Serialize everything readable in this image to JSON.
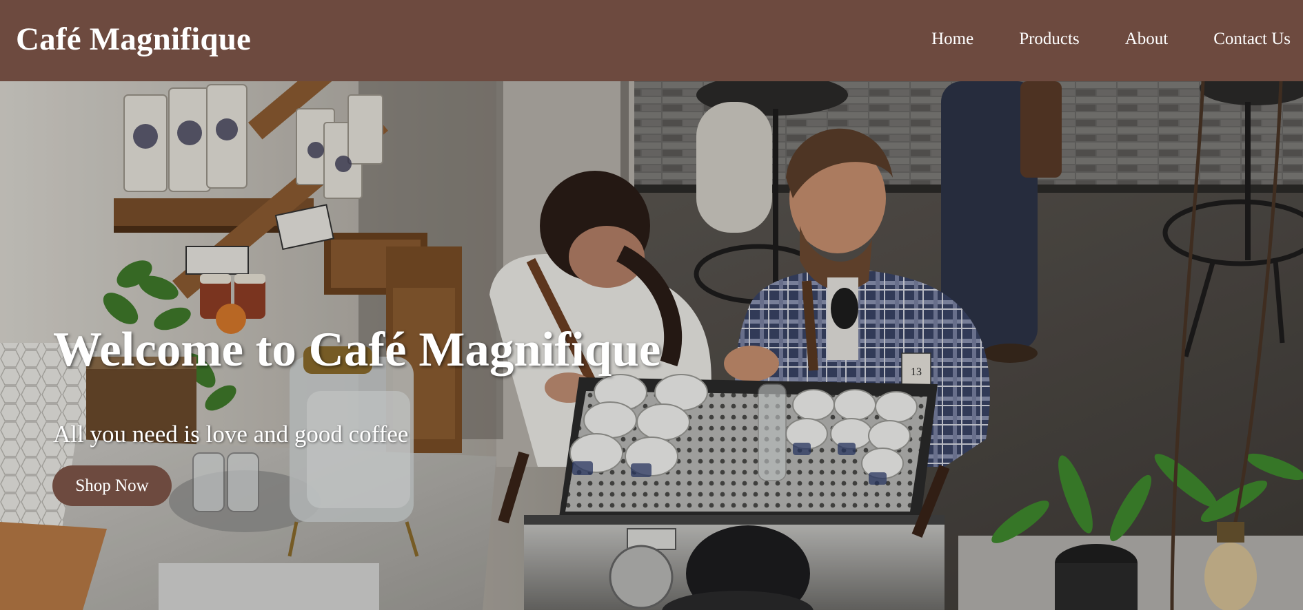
{
  "header": {
    "brand": "Café Magnifique",
    "nav": [
      {
        "label": "Home"
      },
      {
        "label": "Products"
      },
      {
        "label": "About"
      },
      {
        "label": "Contact Us"
      }
    ]
  },
  "hero": {
    "title": "Welcome to Café Magnifique",
    "tagline": "All you need is love and good coffee",
    "cta_label": "Shop Now",
    "cup_number": "13"
  },
  "colors": {
    "brand": "#6d4a3f",
    "text_on_brand": "#ffffff"
  }
}
